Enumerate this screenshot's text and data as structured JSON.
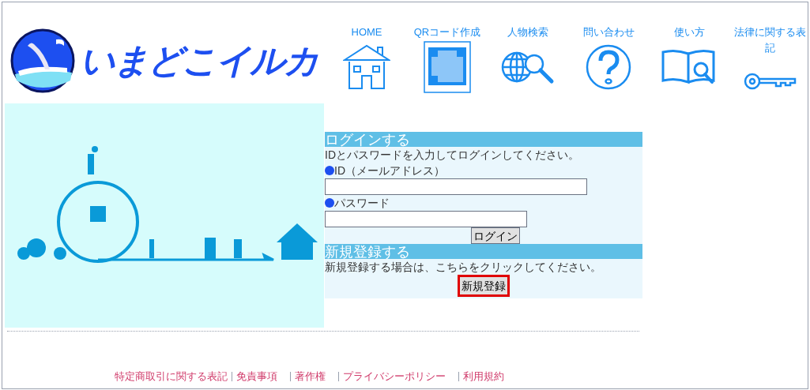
{
  "logo": {
    "text": "いまどこイルカ"
  },
  "nav": [
    {
      "label": "HOME",
      "kind": "home"
    },
    {
      "label": "QRコード作成",
      "kind": "qr"
    },
    {
      "label": "人物検索",
      "kind": "globe"
    },
    {
      "label": "問い合わせ",
      "kind": "question"
    },
    {
      "label": "使い方",
      "kind": "book"
    },
    {
      "label": "法律に関する表記",
      "kind": "key"
    }
  ],
  "illustration": {
    "kind": "picture"
  },
  "login": {
    "heading": "ログインする",
    "instruction": "IDとパスワードを入力してログインしてください。",
    "id_label": "ID（メールアドレス）",
    "password_label": "パスワード",
    "button": "ログイン"
  },
  "register": {
    "heading": "新規登録する",
    "instruction": "新規登録する場合は、こちらをクリックしてください。",
    "button": "新規登録"
  },
  "footer_links": [
    "特定商取引に関する表記",
    "免責事項",
    "著作権",
    "プライバシーポリシー",
    "利用規約"
  ]
}
